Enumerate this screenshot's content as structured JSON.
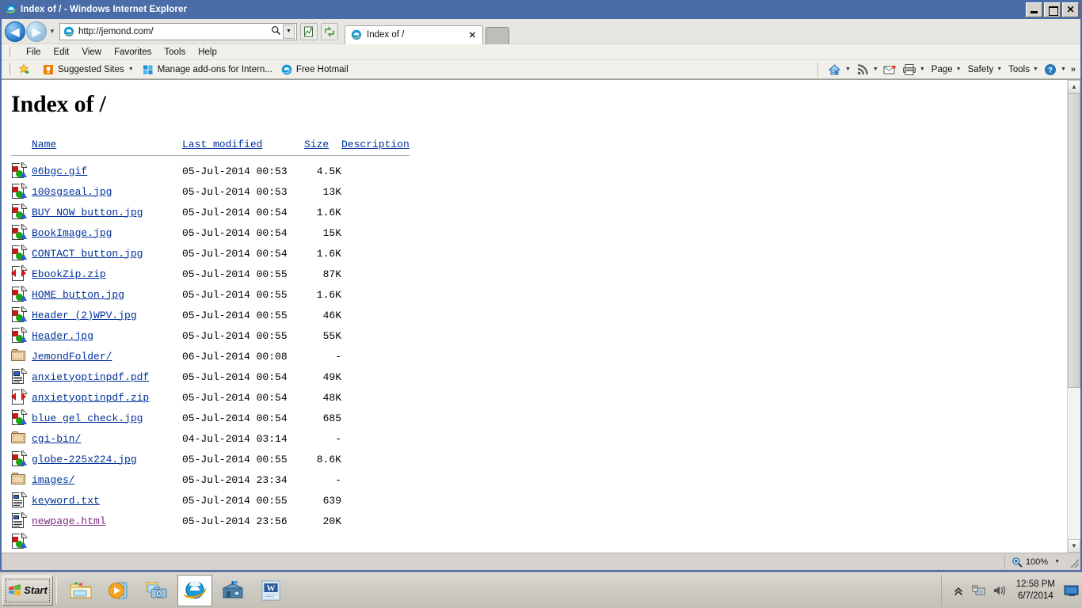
{
  "window": {
    "title": "Index of / - Windows Internet Explorer",
    "icon": "internet-explorer-icon",
    "minimize_label": "Minimize",
    "maximize_label": "Maximize",
    "close_label": "Close"
  },
  "nav": {
    "back_label": "Back",
    "forward_label": "Forward",
    "history_caret": "▼",
    "address_value": "http://jemond.com/",
    "address_placeholder": "http://jemond.com/",
    "search_icon": "search-icon",
    "address_dropdown_caret": "▼",
    "compatibility_label": "Compatibility View",
    "refresh_label": "Refresh"
  },
  "tabs": [
    {
      "title": "Index of /",
      "icon": "internet-explorer-icon",
      "close": "✕",
      "active": true
    }
  ],
  "new_tab_label": "New Tab",
  "menu": {
    "items": [
      "File",
      "Edit",
      "View",
      "Favorites",
      "Tools",
      "Help"
    ]
  },
  "favorites_bar": {
    "add_favorites_label": "Add to Favorites",
    "items": [
      {
        "label": "Suggested Sites",
        "icon": "lightbulb-icon",
        "caret": "▼"
      },
      {
        "label": "Manage add-ons for Intern...",
        "icon": "windows-logo-icon",
        "caret": ""
      },
      {
        "label": "Free Hotmail",
        "icon": "internet-explorer-icon",
        "caret": ""
      }
    ]
  },
  "command_bar": {
    "items": [
      {
        "label": "",
        "icon": "home-icon",
        "caret": "▼"
      },
      {
        "label": "",
        "icon": "feeds-icon",
        "caret": "▼"
      },
      {
        "label": "",
        "icon": "read-mail-icon",
        "caret": ""
      },
      {
        "label": "",
        "icon": "print-icon",
        "caret": "▼"
      },
      {
        "label": "Page",
        "icon": "",
        "caret": "▼"
      },
      {
        "label": "Safety",
        "icon": "",
        "caret": "▼"
      },
      {
        "label": "Tools",
        "icon": "",
        "caret": "▼"
      },
      {
        "label": "",
        "icon": "help-icon",
        "caret": "▼"
      }
    ],
    "overflow": "»"
  },
  "page": {
    "heading": "Index of /",
    "columns": {
      "name": "Name",
      "last_modified": "Last modified",
      "size": "Size",
      "description": "Description"
    },
    "rows": [
      {
        "icon": "image-file-icon",
        "name": "06bgc.gif",
        "modified": "05-Jul-2014 00:53",
        "size": "4.5K",
        "description": "",
        "visited": false
      },
      {
        "icon": "image-file-icon",
        "name": "100sgseal.jpg",
        "modified": "05-Jul-2014 00:53",
        "size": "13K",
        "description": "",
        "visited": false
      },
      {
        "icon": "image-file-icon",
        "name": "BUY NOW button.jpg",
        "modified": "05-Jul-2014 00:54",
        "size": "1.6K",
        "description": "",
        "visited": false
      },
      {
        "icon": "image-file-icon",
        "name": "BookImage.jpg",
        "modified": "05-Jul-2014 00:54",
        "size": "15K",
        "description": "",
        "visited": false
      },
      {
        "icon": "image-file-icon",
        "name": "CONTACT button.jpg",
        "modified": "05-Jul-2014 00:54",
        "size": "1.6K",
        "description": "",
        "visited": false
      },
      {
        "icon": "compressed-file-icon",
        "name": "EbookZip.zip",
        "modified": "05-Jul-2014 00:55",
        "size": "87K",
        "description": "",
        "visited": false
      },
      {
        "icon": "image-file-icon",
        "name": "HOME button.jpg",
        "modified": "05-Jul-2014 00:55",
        "size": "1.6K",
        "description": "",
        "visited": false
      },
      {
        "icon": "image-file-icon",
        "name": "Header (2)WPV.jpg",
        "modified": "05-Jul-2014 00:55",
        "size": "46K",
        "description": "",
        "visited": false
      },
      {
        "icon": "image-file-icon",
        "name": "Header.jpg",
        "modified": "05-Jul-2014 00:55",
        "size": "55K",
        "description": "",
        "visited": false
      },
      {
        "icon": "folder-icon",
        "name": "JemondFolder/",
        "modified": "06-Jul-2014 00:08",
        "size": "-",
        "description": "",
        "visited": false
      },
      {
        "icon": "document-file-icon",
        "name": "anxietyoptinpdf.pdf",
        "modified": "05-Jul-2014 00:54",
        "size": "49K",
        "description": "",
        "visited": false
      },
      {
        "icon": "compressed-file-icon",
        "name": "anxietyoptinpdf.zip",
        "modified": "05-Jul-2014 00:54",
        "size": "48K",
        "description": "",
        "visited": false
      },
      {
        "icon": "image-file-icon",
        "name": "blue gel check.jpg",
        "modified": "05-Jul-2014 00:54",
        "size": "685",
        "description": "",
        "visited": false
      },
      {
        "icon": "folder-icon",
        "name": "cgi-bin/",
        "modified": "04-Jul-2014 03:14",
        "size": "-",
        "description": "",
        "visited": false
      },
      {
        "icon": "image-file-icon",
        "name": "globe-225x224.jpg",
        "modified": "05-Jul-2014 00:55",
        "size": "8.6K",
        "description": "",
        "visited": false
      },
      {
        "icon": "folder-icon",
        "name": "images/",
        "modified": "05-Jul-2014 23:34",
        "size": "-",
        "description": "",
        "visited": false
      },
      {
        "icon": "text-file-icon",
        "name": "keyword.txt",
        "modified": "05-Jul-2014 00:55",
        "size": "639",
        "description": "",
        "visited": false
      },
      {
        "icon": "text-file-icon",
        "name": "newpage.html",
        "modified": "05-Jul-2014 23:56",
        "size": "20K",
        "description": "",
        "visited": true
      },
      {
        "icon": "image-file-icon",
        "name": "",
        "modified": "",
        "size": "",
        "description": "",
        "visited": false
      }
    ]
  },
  "status_bar": {
    "message": "",
    "zoom_level": "100%",
    "zoom_caret": "▼"
  },
  "taskbar": {
    "start_label": "Start",
    "quick_launch": [
      {
        "name": "windows-explorer-icon",
        "active": false
      },
      {
        "name": "media-player-icon",
        "active": false
      },
      {
        "name": "photo-gallery-icon",
        "active": false
      },
      {
        "name": "internet-explorer-icon",
        "active": true
      },
      {
        "name": "network-share-icon",
        "active": false
      },
      {
        "name": "word-icon",
        "active": false
      }
    ],
    "tray": {
      "show_hidden": "show-hidden-icons",
      "network": "network-icon",
      "volume": "volume-icon",
      "time": "12:58 PM",
      "date": "6/7/2014",
      "show_desktop": "show-desktop-icon"
    }
  },
  "colors": {
    "titlebar": "#4a6da7",
    "link": "#00309c",
    "visited_link": "#7d2a7d",
    "chrome": "#d6d3ce"
  }
}
